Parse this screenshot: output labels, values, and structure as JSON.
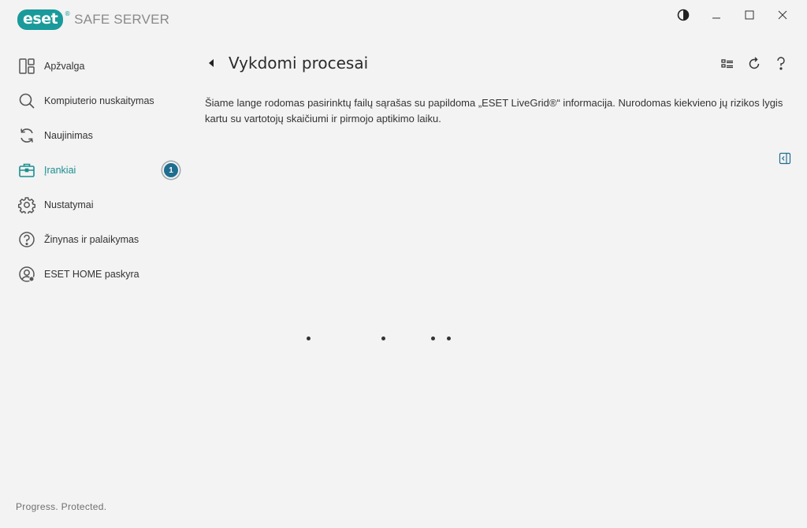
{
  "app": {
    "brand": "eset",
    "brand_reg": "®",
    "product": "SAFE SERVER"
  },
  "window_controls": [
    "theme-toggle",
    "minimize",
    "maximize",
    "close"
  ],
  "sidebar": {
    "items": [
      {
        "label": "Apžvalga",
        "icon": "overview-icon"
      },
      {
        "label": "Kompiuterio nuskaitymas",
        "icon": "search-icon"
      },
      {
        "label": "Naujinimas",
        "icon": "refresh-icon"
      },
      {
        "label": "Įrankiai",
        "icon": "briefcase-icon",
        "active": true,
        "badge": "1"
      },
      {
        "label": "Nustatymai",
        "icon": "gear-icon"
      },
      {
        "label": "Žinynas ir palaikymas",
        "icon": "help-icon"
      },
      {
        "label": "ESET HOME paskyra",
        "icon": "account-icon"
      }
    ]
  },
  "footer": {
    "tagline": "Progress. Protected."
  },
  "main": {
    "title": "Vykdomi procesai",
    "description": "Šiame lange rodomas pasirinktų failų sąrašas su papildoma „ESET LiveGrid®“ informacija. Nurodomas kiekvieno jų rizikos lygis kartu su vartotojų skaičiumi ir pirmojo aptikimo laiku.",
    "tools": [
      "list-view-icon",
      "refresh-icon",
      "help-icon"
    ]
  },
  "colors": {
    "accent": "#1a9a9a",
    "active_nav": "#1a8f8f",
    "badge": "#1f6d8f",
    "background": "#f3f3f4"
  }
}
